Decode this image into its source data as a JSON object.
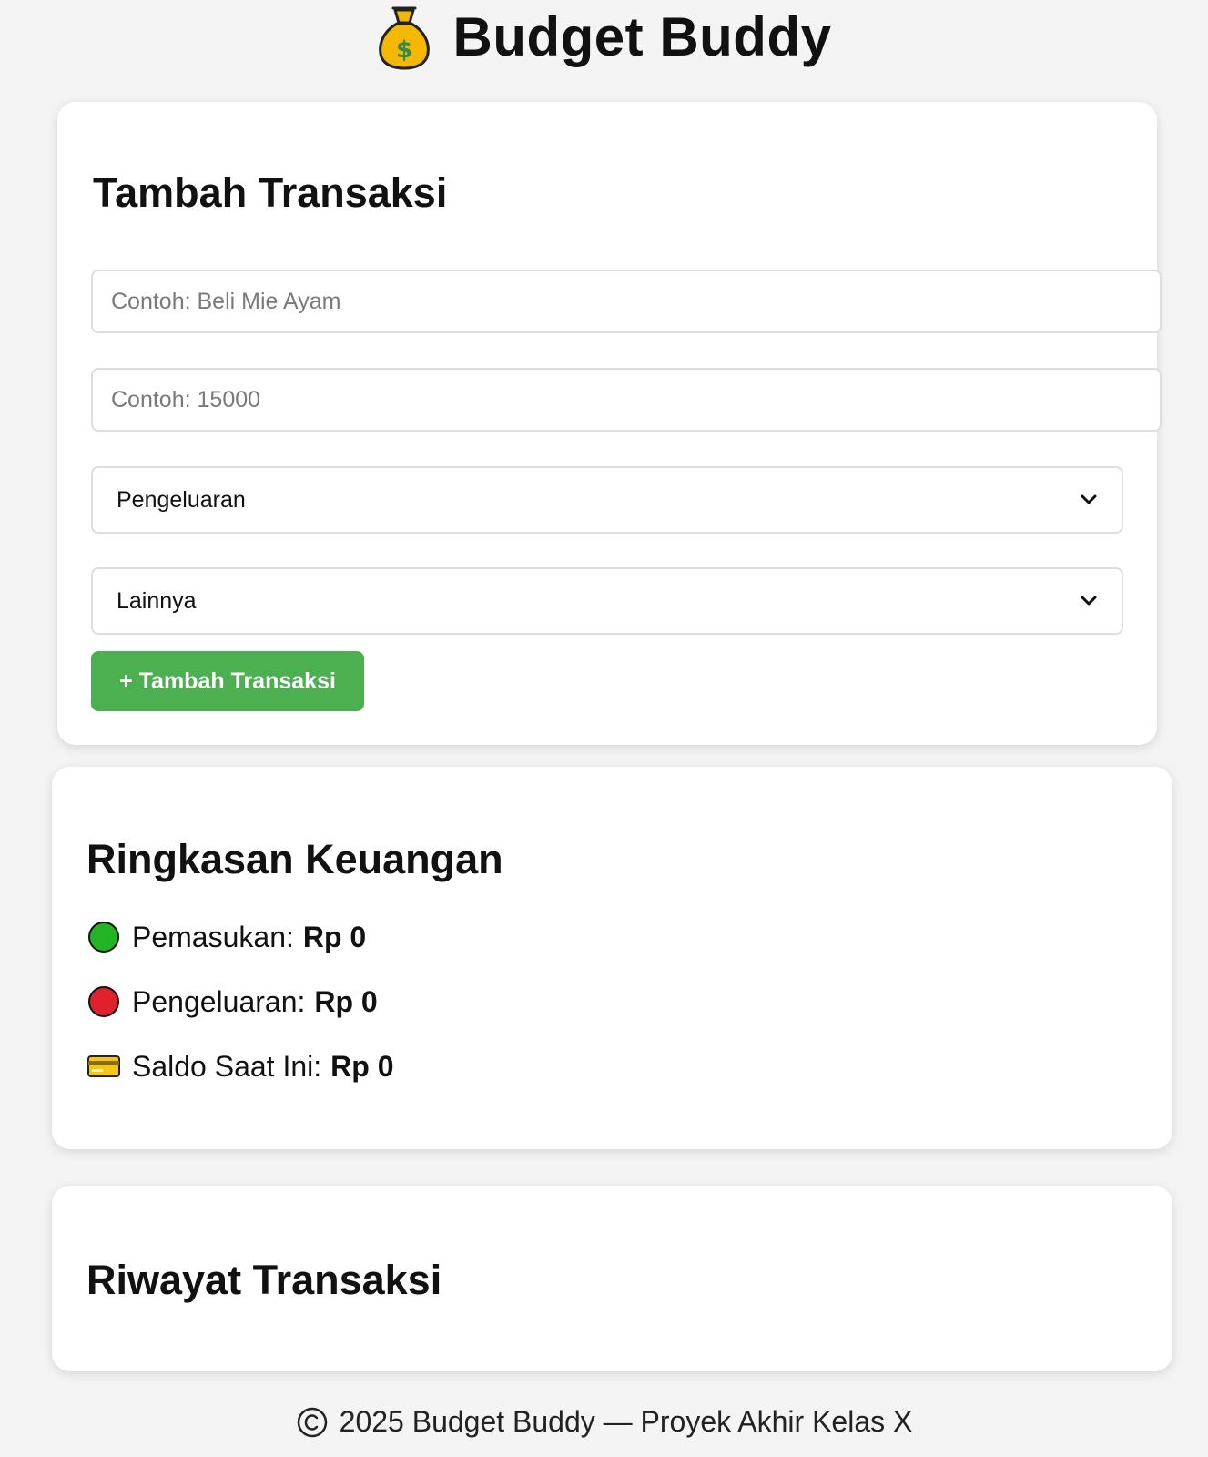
{
  "header": {
    "logo_icon": "money-bag-icon",
    "title": "Budget Buddy"
  },
  "form": {
    "title": "Tambah Transaksi",
    "description_placeholder": "Contoh: Beli Mie Ayam",
    "description_value": "",
    "amount_placeholder": "Contoh: 15000",
    "amount_value": "",
    "type_selected": "Pengeluaran",
    "category_selected": "Lainnya",
    "submit_label": "+ Tambah Transaksi",
    "accent_color": "#4caf50"
  },
  "summary": {
    "title": "Ringkasan Keuangan",
    "income": {
      "icon": "green-circle-icon",
      "label": "Pemasukan:",
      "value": "Rp 0",
      "color": "#22b422"
    },
    "expense": {
      "icon": "red-circle-icon",
      "label": "Pengeluaran:",
      "value": "Rp 0",
      "color": "#e0202c"
    },
    "balance": {
      "icon": "credit-card-icon",
      "label": "Saldo Saat Ini:",
      "value": "Rp 0"
    }
  },
  "history": {
    "title": "Riwayat Transaksi",
    "items": []
  },
  "footer": {
    "icon": "copyright-icon",
    "text": "2025 Budget Buddy — Proyek Akhir Kelas X"
  }
}
